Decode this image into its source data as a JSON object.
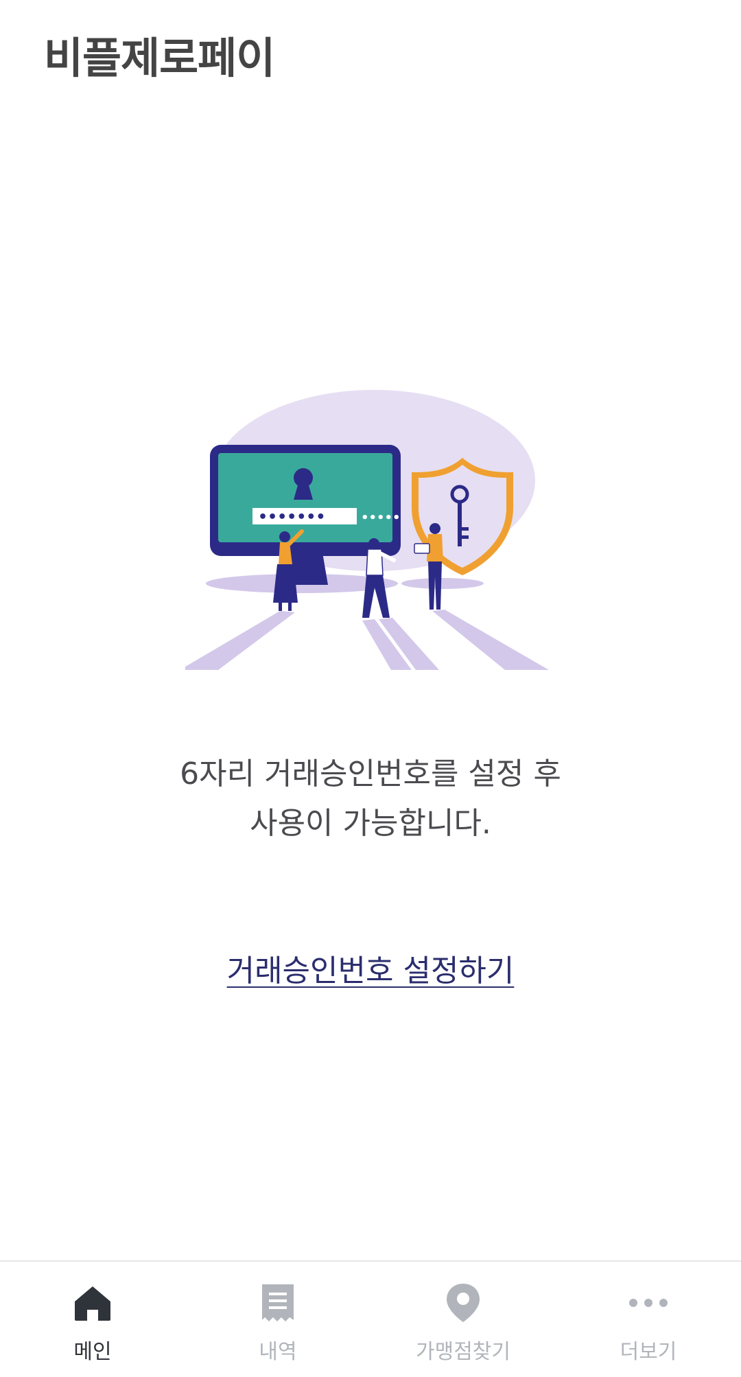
{
  "header": {
    "title": "비플제로페이"
  },
  "illustration": {
    "password_dots": "•••••••",
    "trail_dots": "•••••"
  },
  "message": {
    "line1": "6자리 거래승인번호를 설정 후",
    "line2": "사용이 가능합니다."
  },
  "setup_link": {
    "label": "거래승인번호 설정하기"
  },
  "bottom_nav": {
    "items": [
      {
        "label": "메인",
        "icon": "home-icon",
        "active": true
      },
      {
        "label": "내역",
        "icon": "receipt-icon",
        "active": false
      },
      {
        "label": "가맹점찾기",
        "icon": "location-pin-icon",
        "active": false
      },
      {
        "label": "더보기",
        "icon": "more-dots-icon",
        "active": false
      }
    ]
  },
  "colors": {
    "accent": "#2b2d6e",
    "active_nav": "#2f333a",
    "inactive_nav": "#b1b5bb",
    "screen_teal": "#39a99b",
    "shield_orange": "#f0a030",
    "lavender": "#e6def2"
  }
}
